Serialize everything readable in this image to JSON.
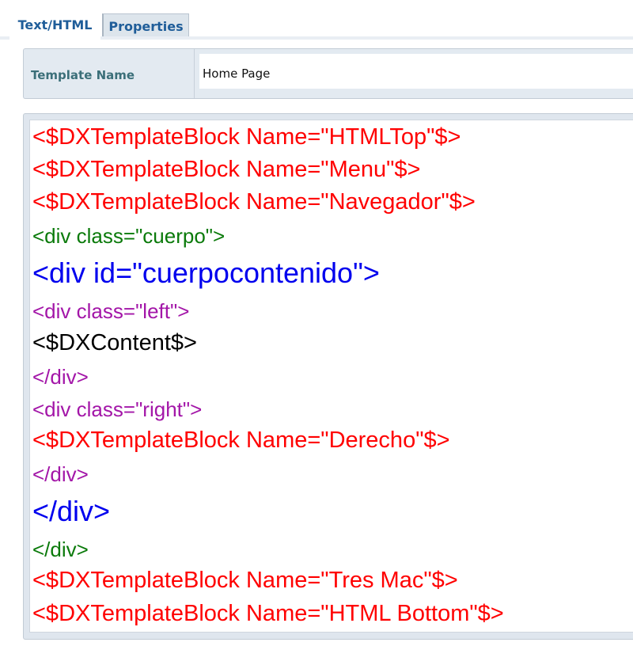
{
  "tabs": [
    {
      "label": "Text/HTML",
      "active": true
    },
    {
      "label": "Properties",
      "active": false
    }
  ],
  "template_name": {
    "label": "Template Name",
    "value": "Home Page"
  },
  "editor": {
    "colors": {
      "block": "#ff0000",
      "outer_div": "#0a7a0a",
      "id_div": "#0000ee",
      "inner_div": "#a316a8",
      "content": "#000000"
    },
    "lines": [
      "<$DXTemplateBlock Name=\"HTMLTop\"$>",
      "<$DXTemplateBlock Name=\"Menu\"$>",
      "<$DXTemplateBlock Name=\"Navegador\"$>",
      "<div class=\"cuerpo\">",
      "<div id=\"cuerpocontenido\">",
      "<div class=\"left\">",
      "<$DXContent$>",
      "</div>",
      "<div class=\"right\">",
      "<$DXTemplateBlock Name=\"Derecho\"$>",
      "</div>",
      "</div>",
      "</div>",
      "<$DXTemplateBlock Name=\"Tres Mac\"$>",
      "<$DXTemplateBlock Name=\"HTML Bottom\"$>"
    ]
  }
}
